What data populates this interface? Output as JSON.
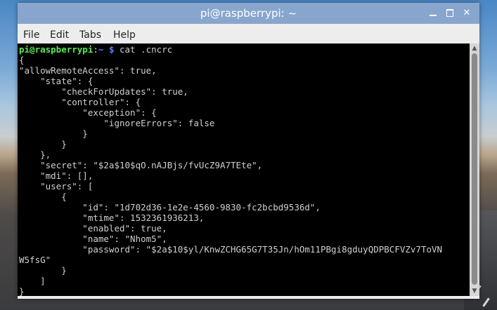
{
  "window": {
    "title": "pi@raspberrypi: ~"
  },
  "menubar": {
    "file": "File",
    "edit": "Edit",
    "tabs": "Tabs",
    "help": "Help"
  },
  "terminal": {
    "prompt_user": "pi@raspberrypi",
    "prompt_sep": ":",
    "prompt_path": "~ $",
    "command": " cat .cncrc",
    "output": "{\n\"allowRemoteAccess\": true,\n    \"state\": {\n        \"checkForUpdates\": true,\n        \"controller\": {\n            \"exception\": {\n                \"ignoreErrors\": false\n            }\n        }\n    },\n    \"secret\": \"$2a$10$qO.nAJBjs/fvUcZ9A7TEte\",\n    \"mdi\": [],\n    \"users\": [\n        {\n            \"id\": \"1d702d36-1e2e-4560-9830-fc2bcbd9536d\",\n            \"mtime\": 1532361936213,\n            \"enabled\": true,\n            \"name\": \"Nhom5\",\n            \"password\": \"$2a$10$yl/KnwZCHG65G7T35Jn/hOm11PBgi8gduyQDPBCFVZv7ToVN\nW5fsG\"\n        }\n    ]\n}"
  },
  "icons": {
    "minimize": "minimize-icon",
    "maximize": "maximize-icon",
    "close": "close-icon",
    "scroll_up": "scroll-up-arrow-icon",
    "scroll_down": "scroll-down-arrow-icon"
  },
  "colors": {
    "titlebar": "#88a6cd",
    "prompt_user": "#58e85a",
    "prompt_path": "#5f7fff",
    "terminal_bg": "#000000",
    "terminal_fg": "#d0d0d0"
  }
}
